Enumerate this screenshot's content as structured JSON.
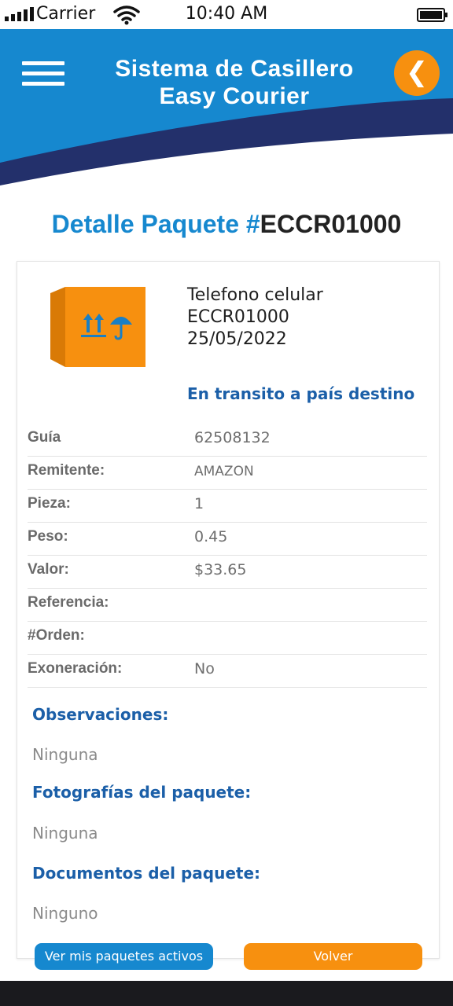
{
  "status_bar": {
    "carrier": "Carrier",
    "time": "10:40 AM"
  },
  "header": {
    "title_line1": "Sistema de Casillero",
    "title_line2": "Easy Courier",
    "back_icon": "chevron-left-icon",
    "menu_icon": "hamburger-menu-icon"
  },
  "page_title": {
    "label": "Detalle Paquete #",
    "code": "ECCR01000"
  },
  "package": {
    "icon": "package-box-icon",
    "description": "Telefono celular",
    "code": "ECCR01000",
    "date": "25/05/2022",
    "status": "En transito a país destino"
  },
  "details": [
    {
      "label": "Guía",
      "value": "62508132"
    },
    {
      "label": "Remitente:",
      "value": "AMAZON"
    },
    {
      "label": "Pieza:",
      "value": "1"
    },
    {
      "label": "Peso:",
      "value": "0.45"
    },
    {
      "label": "Valor:",
      "value": "$33.65"
    },
    {
      "label": "Referencia:",
      "value": ""
    },
    {
      "label": "#Orden:",
      "value": ""
    },
    {
      "label": "Exoneración:",
      "value": "No"
    }
  ],
  "sections": {
    "observaciones": {
      "title": "Observaciones:",
      "value": "Ninguna"
    },
    "fotografias": {
      "title": "Fotografías del paquete:",
      "value": "Ninguna"
    },
    "documentos": {
      "title": "Documentos del paquete:",
      "value": "Ninguno"
    }
  },
  "buttons": {
    "active_packages": "Ver mis paquetes activos",
    "back": "Volver"
  },
  "colors": {
    "primary_blue": "#1688cf",
    "dark_blue": "#1b5fa8",
    "navy": "#23306b",
    "orange": "#f7900f"
  }
}
